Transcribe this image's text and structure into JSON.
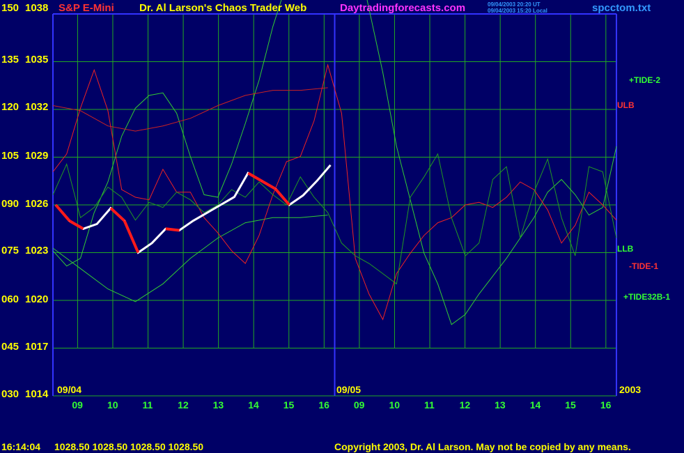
{
  "header": {
    "instrument": "S&P E-Mini",
    "author": "Dr. Al Larson's Chaos Trader Web",
    "site": "Daytradingforecasts.com",
    "stamp_ut": "09/04/2003 20:20 UT",
    "stamp_local": "09/04/2003 15:20 Local",
    "filename": "spcctom.txt"
  },
  "footer": {
    "time": "16:14:04",
    "quote": "1028.50 1028.50 1028.50 1028.50",
    "copyright": "Copyright 2003, Dr. Al Larson. May not be copied by any means."
  },
  "colors": {
    "background": "#000066",
    "grid": "#22aa22",
    "axis": "#3333ff",
    "price_up": "#ffffff",
    "price_down": "#ff1a1a",
    "ulb": "#cc2222",
    "llb": "#33cc33",
    "tide2": "#33cc33",
    "tide1": "#ee2222",
    "tide32b": "#229922",
    "label_yellow": "#ffff00",
    "label_red": "#ff3333",
    "label_magenta": "#ff33ff",
    "label_cyan": "#3399ff",
    "label_green": "#33ff33"
  },
  "chart_data": {
    "type": "line",
    "title": "S&P E-Mini",
    "y_left_ticks": [
      "150",
      "135",
      "120",
      "105",
      "090",
      "075",
      "060",
      "045",
      "030"
    ],
    "y_price_ticks": [
      "1038",
      "1035",
      "1032",
      "1029",
      "1026",
      "1023",
      "1020",
      "1017",
      "1014"
    ],
    "ylim": [
      1014,
      1038
    ],
    "date_labels": [
      "09/04",
      "09/05",
      "2003"
    ],
    "x_hour_labels": [
      "09",
      "10",
      "11",
      "12",
      "13",
      "14",
      "15",
      "16",
      "09",
      "10",
      "11",
      "12",
      "13",
      "14",
      "15",
      "16"
    ],
    "series": [
      {
        "name": "+TIDE-2",
        "values": [
          [
            0,
            57
          ],
          [
            1,
            51
          ],
          [
            2,
            54
          ],
          [
            3,
            72
          ],
          [
            4,
            84
          ],
          [
            5,
            102
          ],
          [
            6,
            113
          ],
          [
            7,
            118
          ],
          [
            8,
            119
          ],
          [
            9,
            111
          ],
          [
            10,
            94
          ],
          [
            11,
            79
          ],
          [
            12,
            78
          ],
          [
            13,
            91
          ],
          [
            14,
            107
          ],
          [
            15,
            124
          ],
          [
            16,
            145
          ],
          [
            17,
            162
          ],
          [
            18,
            188
          ],
          [
            19,
            217
          ],
          [
            20,
            212
          ],
          [
            21,
            196
          ],
          [
            22,
            177
          ],
          [
            23,
            152
          ],
          [
            24,
            127
          ],
          [
            25,
            98
          ],
          [
            26,
            77
          ],
          [
            27,
            56
          ],
          [
            28,
            44
          ],
          [
            29,
            28
          ],
          [
            30,
            32
          ],
          [
            31,
            40
          ],
          [
            32,
            47
          ],
          [
            33,
            54
          ],
          [
            34,
            62
          ],
          [
            35,
            70
          ],
          [
            36,
            80
          ],
          [
            37,
            85
          ],
          [
            38,
            79
          ],
          [
            39,
            71
          ],
          [
            40,
            74
          ],
          [
            41,
            98
          ]
        ]
      },
      {
        "name": "ULB",
        "values": [
          [
            0,
            114
          ],
          [
            2,
            112
          ],
          [
            4,
            106
          ],
          [
            6,
            104
          ],
          [
            8,
            106
          ],
          [
            10,
            109
          ],
          [
            12,
            114
          ],
          [
            14,
            118
          ],
          [
            16,
            120
          ],
          [
            18,
            120
          ],
          [
            20,
            121
          ]
        ]
      },
      {
        "name": "LLB",
        "values": [
          [
            0,
            58
          ],
          [
            2,
            50
          ],
          [
            4,
            42
          ],
          [
            6,
            37
          ],
          [
            8,
            44
          ],
          [
            10,
            54
          ],
          [
            12,
            62
          ],
          [
            14,
            68
          ],
          [
            16,
            70
          ],
          [
            18,
            70
          ],
          [
            20,
            71
          ]
        ]
      },
      {
        "name": "-TIDE-1",
        "values": [
          [
            0,
            88
          ],
          [
            1,
            95
          ],
          [
            2,
            113
          ],
          [
            3,
            128
          ],
          [
            4,
            112
          ],
          [
            5,
            81
          ],
          [
            6,
            78
          ],
          [
            7,
            77
          ],
          [
            8,
            89
          ],
          [
            9,
            80
          ],
          [
            10,
            80
          ],
          [
            11,
            70
          ],
          [
            12,
            64
          ],
          [
            13,
            57
          ],
          [
            14,
            52
          ],
          [
            15,
            63
          ],
          [
            16,
            79
          ],
          [
            17,
            92
          ],
          [
            18,
            94
          ],
          [
            19,
            108
          ],
          [
            20,
            130
          ],
          [
            21,
            111
          ],
          [
            22,
            54
          ],
          [
            23,
            40
          ],
          [
            24,
            30
          ],
          [
            25,
            48
          ],
          [
            26,
            56
          ],
          [
            27,
            63
          ],
          [
            28,
            68
          ],
          [
            29,
            70
          ],
          [
            30,
            75
          ],
          [
            31,
            76
          ],
          [
            32,
            74
          ],
          [
            33,
            78
          ],
          [
            34,
            84
          ],
          [
            35,
            81
          ],
          [
            36,
            73
          ],
          [
            37,
            60
          ],
          [
            38,
            67
          ],
          [
            39,
            80
          ],
          [
            40,
            75
          ],
          [
            41,
            69
          ]
        ]
      },
      {
        "name": "+TIDE32B-1",
        "values": [
          [
            0,
            79
          ],
          [
            1,
            91
          ],
          [
            2,
            70
          ],
          [
            3,
            74
          ],
          [
            4,
            82
          ],
          [
            5,
            78
          ],
          [
            6,
            69
          ],
          [
            7,
            76
          ],
          [
            8,
            74
          ],
          [
            9,
            80
          ],
          [
            10,
            77
          ],
          [
            11,
            72
          ],
          [
            12,
            75
          ],
          [
            13,
            81
          ],
          [
            14,
            78
          ],
          [
            15,
            84
          ],
          [
            16,
            79
          ],
          [
            17,
            75
          ],
          [
            18,
            86
          ],
          [
            19,
            78
          ],
          [
            20,
            72
          ],
          [
            21,
            60
          ],
          [
            22,
            55
          ],
          [
            23,
            52
          ],
          [
            24,
            48
          ],
          [
            25,
            44
          ],
          [
            26,
            78
          ],
          [
            27,
            86
          ],
          [
            28,
            95
          ],
          [
            29,
            70
          ],
          [
            30,
            55
          ],
          [
            31,
            60
          ],
          [
            32,
            85
          ],
          [
            33,
            90
          ],
          [
            34,
            62
          ],
          [
            35,
            80
          ],
          [
            36,
            93
          ],
          [
            37,
            70
          ],
          [
            38,
            55
          ],
          [
            39,
            90
          ],
          [
            40,
            88
          ],
          [
            41,
            62
          ]
        ]
      },
      {
        "name": "price",
        "values": [
          [
            0,
            1026.0
          ],
          [
            1,
            1025.0
          ],
          [
            2,
            1024.5
          ],
          [
            3,
            1024.8
          ],
          [
            4,
            1025.8
          ],
          [
            5,
            1025.0
          ],
          [
            6,
            1023.0
          ],
          [
            7,
            1023.6
          ],
          [
            8,
            1024.5
          ],
          [
            9,
            1024.4
          ],
          [
            10,
            1025.0
          ],
          [
            11,
            1025.5
          ],
          [
            12,
            1026.0
          ],
          [
            13,
            1026.5
          ],
          [
            14,
            1028.0
          ],
          [
            15,
            1027.5
          ],
          [
            16,
            1027.0
          ],
          [
            17,
            1026.0
          ],
          [
            18,
            1026.6
          ],
          [
            19,
            1027.5
          ],
          [
            20,
            1028.5
          ]
        ]
      }
    ],
    "x_range": [
      0,
      41
    ],
    "grid": true
  },
  "labels": {
    "tide2": "+TIDE-2",
    "ulb": "ULB",
    "llb": "LLB",
    "tide1": "-TIDE-1",
    "tide32b": "+TIDE32B-1"
  }
}
